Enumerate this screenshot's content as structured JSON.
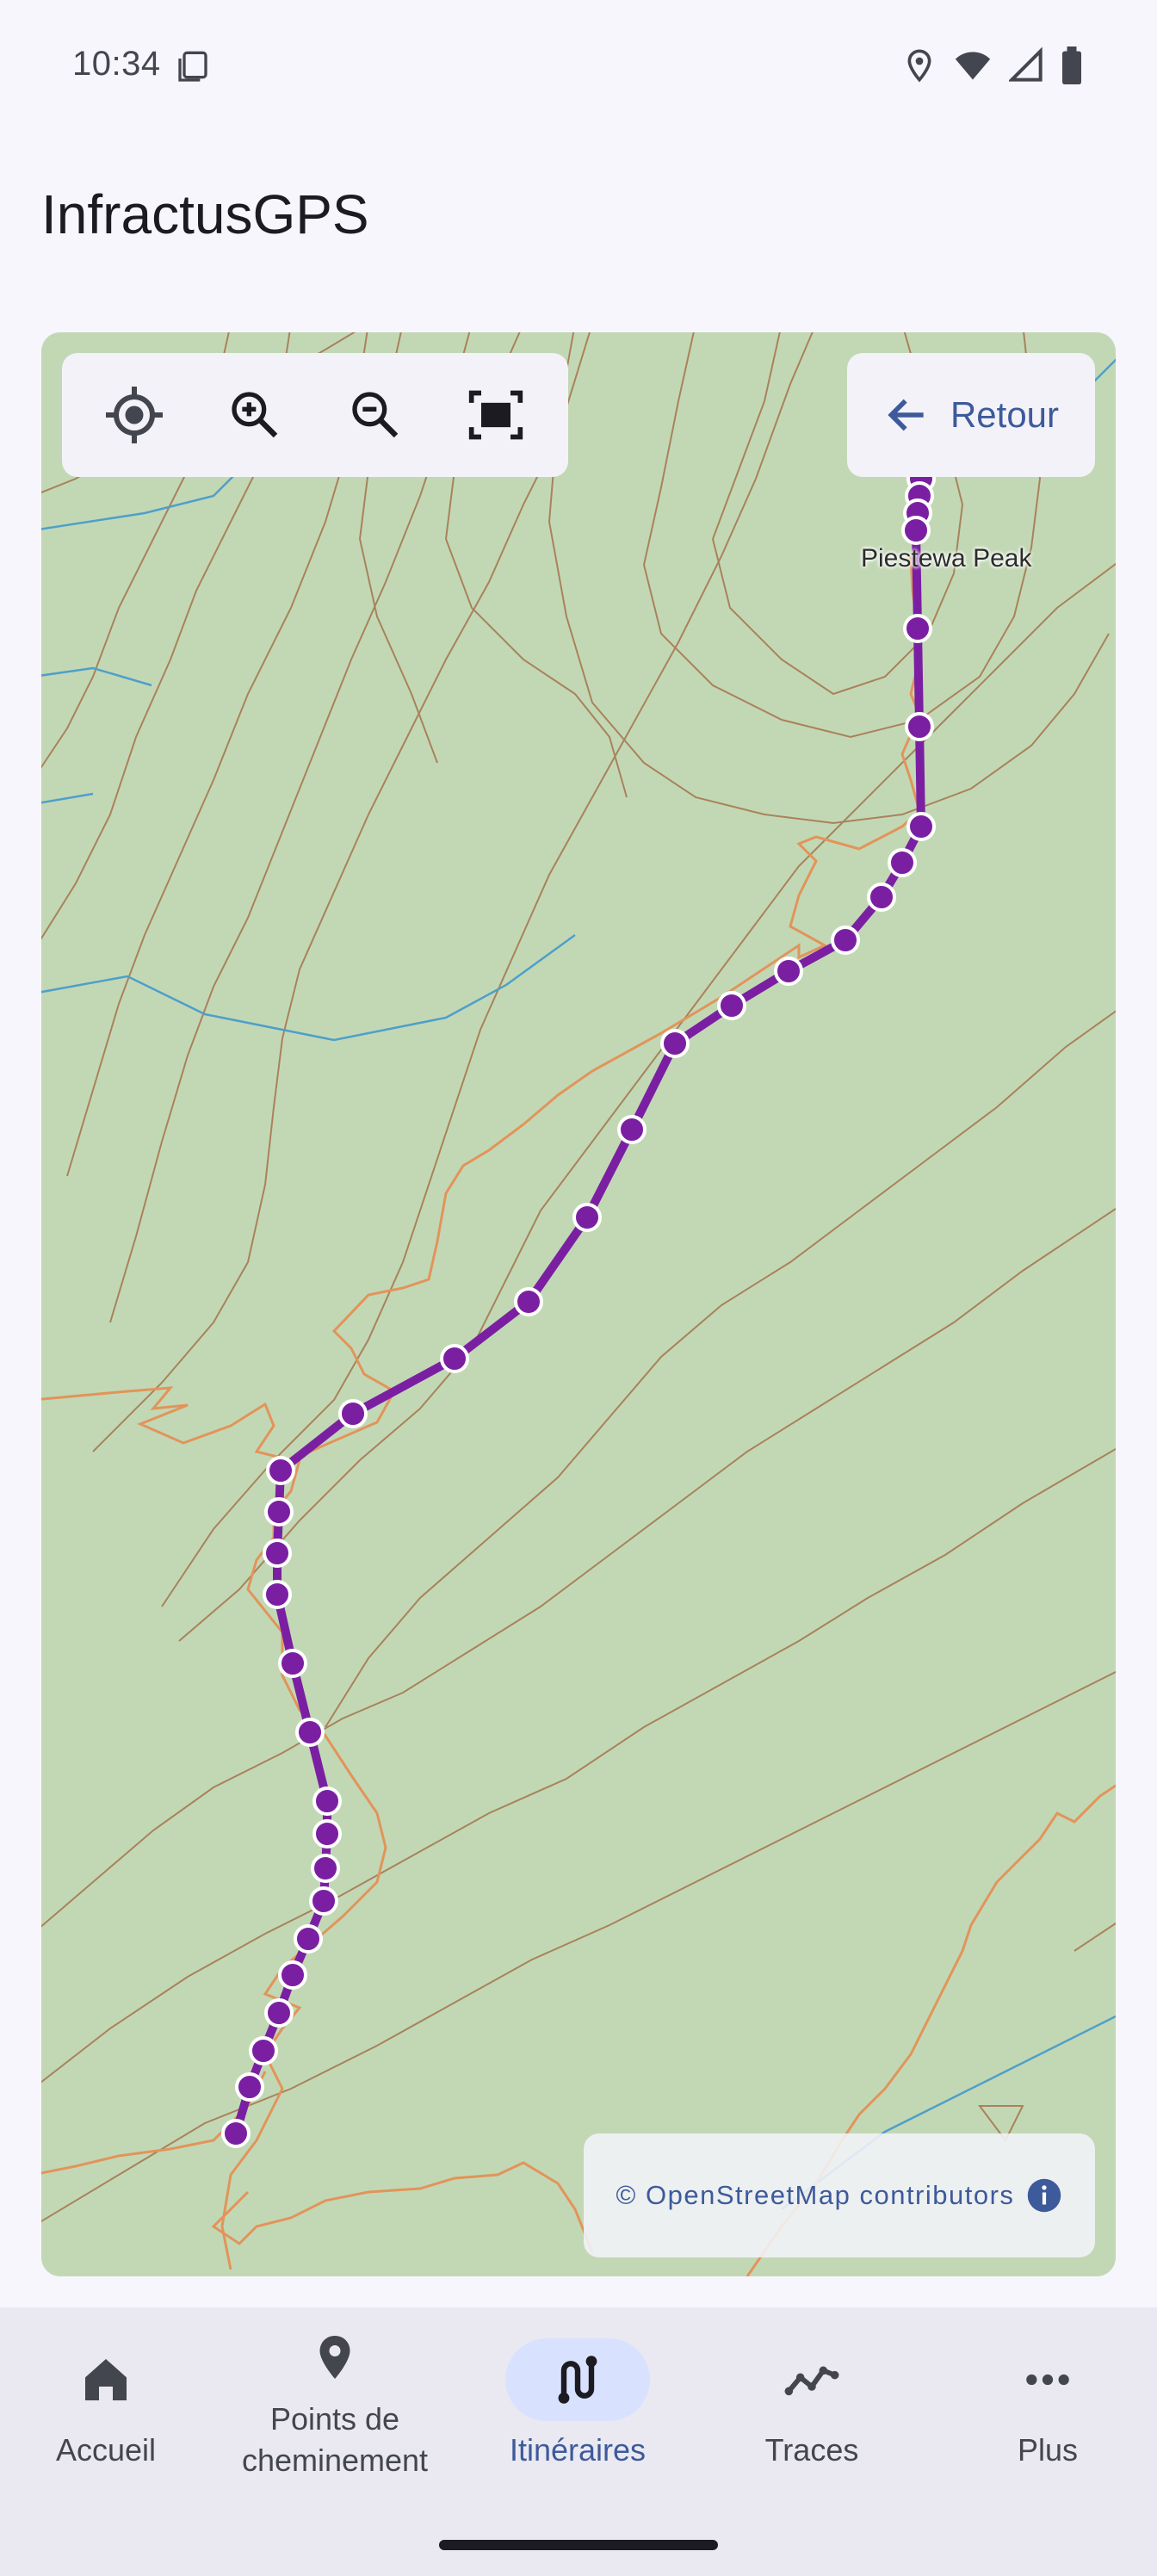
{
  "status_bar": {
    "time": "10:34"
  },
  "app": {
    "title": "InfractusGPS"
  },
  "map_toolbar": {
    "icons": [
      "my-location-icon",
      "zoom-in-icon",
      "zoom-out-icon",
      "fit-screen-icon"
    ]
  },
  "back_button": {
    "label": "Retour"
  },
  "map": {
    "peak_label": "Piestewa Peak",
    "attribution": "© OpenStreetMap contributors",
    "colors": {
      "land": "#c2d8b5",
      "contour": "#a9825b",
      "trail": "#e2945a",
      "water": "#4f9fc9",
      "route": "#7b1fa2",
      "accent": "#3d5a9b"
    }
  },
  "bottom_nav": {
    "items": [
      {
        "label": "Accueil",
        "icon": "home-icon",
        "active": false
      },
      {
        "label": "Points de\ncheminement",
        "icon": "place-icon",
        "active": false
      },
      {
        "label": "Itinéraires",
        "icon": "route-icon",
        "active": true
      },
      {
        "label": "Traces",
        "icon": "trace-icon",
        "active": false
      },
      {
        "label": "Plus",
        "icon": "more-icon",
        "active": false
      }
    ]
  }
}
